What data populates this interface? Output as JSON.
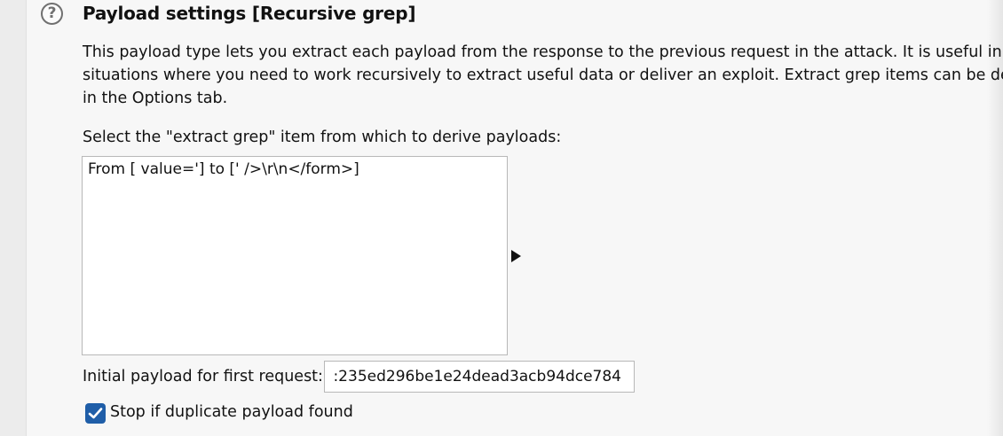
{
  "header": {
    "help_icon": "?",
    "title": "Payload settings [Recursive grep]"
  },
  "description": {
    "lines": [
      "This payload type lets you extract each payload from the response to the previous request in the attack. It is useful in som",
      "situations where you need to work recursively to extract useful data or deliver an exploit. Extract grep items can be define",
      "in the Options tab."
    ]
  },
  "grep": {
    "label": "Select the \"extract grep\" item from which to derive payloads:",
    "items": [
      "From [ value='] to [' />\\r\\n</form>]"
    ]
  },
  "initial_payload": {
    "label": "Initial payload for first request:",
    "value": ":235ed296be1e24dead3acb94dce784"
  },
  "stop_duplicate": {
    "label": "Stop if duplicate payload found",
    "checked": true
  },
  "colors": {
    "checkbox_accent": "#1f5ea8"
  }
}
